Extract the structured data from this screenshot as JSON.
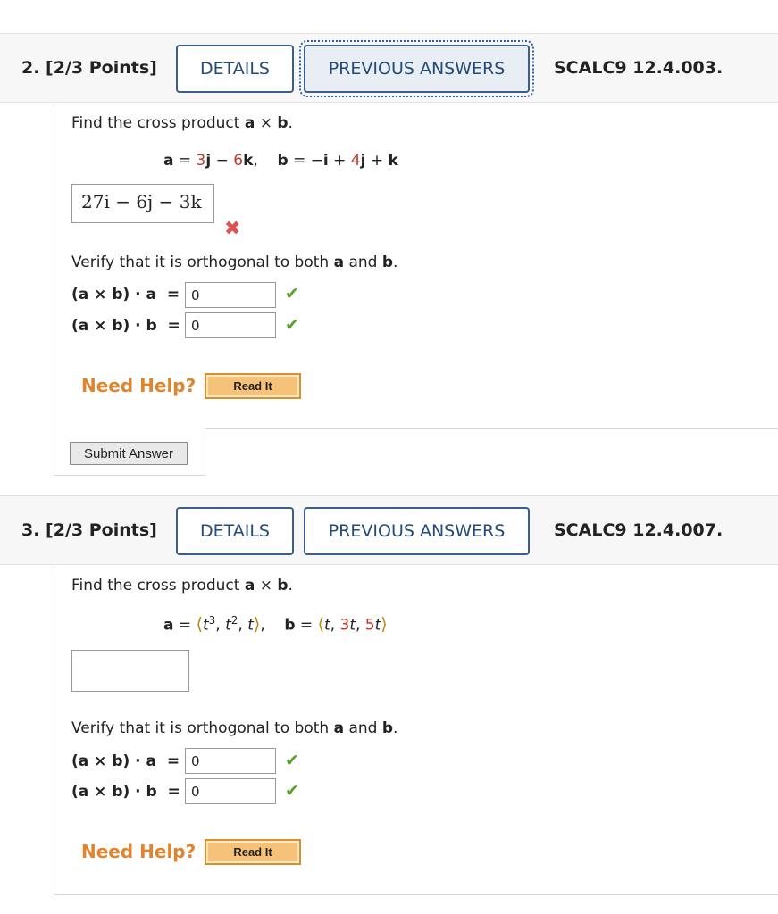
{
  "q2": {
    "title": "2. [2/3 Points]",
    "details_label": "DETAILS",
    "previous_label": "PREVIOUS ANSWERS",
    "ref": "SCALC9 12.4.003.",
    "prompt": {
      "pre": "Find the cross product ",
      "a": "a",
      "times": " × ",
      "b": "b",
      "post": "."
    },
    "vectors": {
      "a_name": "a",
      "eq1": " = ",
      "a_c1": "3",
      "a_u1": "j",
      "a_sep": " − ",
      "a_c2": "6",
      "a_u2": "k",
      "comma": ",",
      "b_name": "b",
      "eq2": " = −",
      "b_u1": "i",
      "b_plus1": " + ",
      "b_c2": "4",
      "b_u2": "j",
      "b_plus2": " + ",
      "b_u3": "k"
    },
    "answer": "27i − 6j − 3k",
    "verify": {
      "pre": "Verify that it is orthogonal to both ",
      "a": "a",
      "and": " and ",
      "b": "b",
      "post": "."
    },
    "dot_a_label": "(a × b) · a  =",
    "dot_a_value": "0",
    "dot_b_label": "(a × b) · b  =",
    "dot_b_value": "0",
    "need_help": "Need Help?",
    "read_it": "Read It",
    "submit": "Submit Answer"
  },
  "q3": {
    "title": "3. [2/3 Points]",
    "details_label": "DETAILS",
    "previous_label": "PREVIOUS ANSWERS",
    "ref": "SCALC9 12.4.007.",
    "prompt": {
      "pre": "Find the cross product ",
      "a": "a",
      "times": " × ",
      "b": "b",
      "post": "."
    },
    "vectors": {
      "a_name": "a",
      "eq1": " = ",
      "langle1": "⟨",
      "a_t": "t",
      "a_e1": "3",
      "a_s1": ", ",
      "a_t2": "t",
      "a_e2": "2",
      "a_s2": ", ",
      "a_t3": "t",
      "rangle1": "⟩",
      "comma": ",",
      "b_name": "b",
      "eq2": " = ",
      "langle2": "⟨",
      "b_t1": "t",
      "b_s1": ", ",
      "b_c2": "3",
      "b_t2": "t",
      "b_s2": ", ",
      "b_c3": "5",
      "b_t3": "t",
      "rangle2": "⟩"
    },
    "answer": "",
    "verify": {
      "pre": "Verify that it is orthogonal to both ",
      "a": "a",
      "and": " and ",
      "b": "b",
      "post": "."
    },
    "dot_a_label": "(a × b) · a  =",
    "dot_a_value": "0",
    "dot_b_label": "(a × b) · b  =",
    "dot_b_value": "0",
    "need_help": "Need Help?",
    "read_it": "Read It"
  },
  "icons": {
    "wrong": "x-mark-icon",
    "correct": "check-mark-icon"
  },
  "colors": {
    "accent": "#244b78",
    "wrong": "#e05050",
    "correct": "#5aa02c",
    "help": "#e0852e",
    "button_orange": "#f6c27a"
  }
}
